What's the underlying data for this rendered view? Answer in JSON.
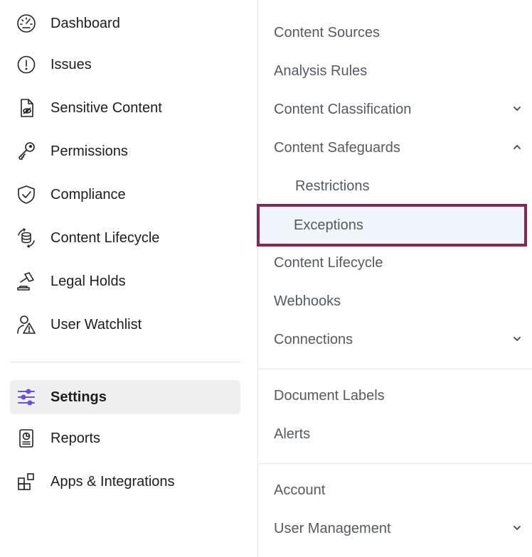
{
  "nav": {
    "items": [
      {
        "label": "Dashboard",
        "icon": "dashboard-icon"
      },
      {
        "label": "Issues",
        "icon": "alert-circle-icon"
      },
      {
        "label": "Sensitive Content",
        "icon": "sensitive-file-icon"
      },
      {
        "label": "Permissions",
        "icon": "key-icon"
      },
      {
        "label": "Compliance",
        "icon": "shield-check-icon"
      },
      {
        "label": "Content Lifecycle",
        "icon": "database-cycle-icon"
      },
      {
        "label": "Legal Holds",
        "icon": "gavel-icon"
      },
      {
        "label": "User Watchlist",
        "icon": "user-warning-icon"
      }
    ],
    "bottom_items": [
      {
        "label": "Settings",
        "icon": "sliders-icon",
        "active": true
      },
      {
        "label": "Reports",
        "icon": "report-icon"
      },
      {
        "label": "Apps & Integrations",
        "icon": "apps-icon"
      }
    ],
    "active_icon_color": "#6b4fd8"
  },
  "settings_menu": {
    "group1": [
      {
        "label": "Content Sources"
      },
      {
        "label": "Analysis Rules"
      },
      {
        "label": "Content Classification",
        "chevron": "down"
      },
      {
        "label": "Content Safeguards",
        "chevron": "up"
      },
      {
        "label": "Restrictions",
        "child": true
      },
      {
        "label": "Exceptions",
        "child": true,
        "selected": true
      },
      {
        "label": "Content Lifecycle"
      },
      {
        "label": "Webhooks"
      },
      {
        "label": "Connections",
        "chevron": "down"
      }
    ],
    "group2": [
      {
        "label": "Document Labels"
      },
      {
        "label": "Alerts"
      }
    ],
    "group3": [
      {
        "label": "Account"
      },
      {
        "label": "User Management",
        "chevron": "down"
      }
    ],
    "selected_border_color": "#832a52",
    "selected_bg_color": "#f0f5fc"
  }
}
